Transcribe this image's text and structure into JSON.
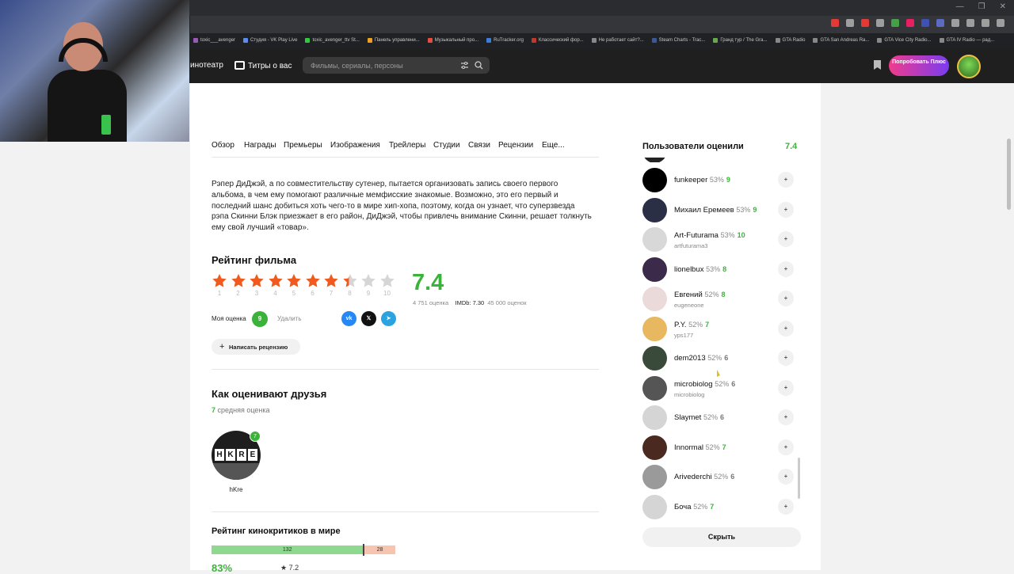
{
  "browser": {
    "bookmarks": [
      "toxic___avenger",
      "Студия - VK Play Live",
      "toxic_avenger_ttv St...",
      "Панель управлени...",
      "Музыкальный про...",
      "RuTracker.org",
      "Классический фор...",
      "Не работает сайт?...",
      "Steam Charts - Trac...",
      "Гранд тур / The Gra...",
      "GTA Radio",
      "GTA San Andreas Ra...",
      "GTA Vice City Radio...",
      "GTA IV Radio — рад..."
    ],
    "bookmark_colors": [
      "#9b59b6",
      "#5a8dee",
      "#2ecc40",
      "#f0a020",
      "#e74c3c",
      "#3b7dd8",
      "#c0392b",
      "#888888",
      "#3b5998",
      "#6aa84f",
      "#888888",
      "#888888",
      "#888888",
      "#888888"
    ],
    "ext_colors": [
      "#e53935",
      "#9e9e9e",
      "#e53935",
      "#9e9e9e",
      "#43a047",
      "#e91e63",
      "#3f51b5",
      "#5c6bc0",
      "#9e9e9e",
      "#9e9e9e",
      "#9e9e9e",
      "#9e9e9e"
    ]
  },
  "header": {
    "nav_cinema": "инотеатр",
    "nav_credits": "Титры о вас",
    "search_placeholder": "Фильмы, сериалы, персоны",
    "plus_button": "Попробовать Плюс"
  },
  "tabs": [
    "Обзор",
    "Награды",
    "Премьеры",
    "Изображения",
    "Трейлеры",
    "Студии",
    "Связи",
    "Рецензии",
    "Еще..."
  ],
  "description": "Рэпер ДиДжэй, а по совместительству сутенер, пытается организовать запись своего первого альбома, в чем ему помогают различные мемфисские знакомые. Возможно, это его первый и последний шанс добиться хоть чего-то в мире хип-хопа, поэтому, когда он узнает, что суперзвезда рэпа Скинни Блэк приезжает в его район, ДиДжэй, чтобы привлечь внимание Скинни, решает толкнуть ему свой лучший «товар».",
  "rating": {
    "title": "Рейтинг фильма",
    "value": "7.4",
    "value_numeric": 7.4,
    "max": 10,
    "star_labels": [
      "1",
      "2",
      "3",
      "4",
      "5",
      "6",
      "7",
      "8",
      "9",
      "10"
    ],
    "count": "4 751 оценка",
    "imdb_label": "IMDb: 7.30",
    "imdb_count": "45 000 оценок",
    "my_rating_label": "Моя оценка",
    "my_rating": "9",
    "remove_label": "Удалить",
    "share": [
      "vk",
      "x",
      "telegram"
    ],
    "write_review": "Написать рецензию"
  },
  "friends": {
    "title": "Как оценивают друзья",
    "avg_value": "7",
    "avg_label": "средняя оценка",
    "items": [
      {
        "name": "hKre",
        "score": "7",
        "avatar_text": [
          "H",
          "K",
          "R",
          "E"
        ]
      }
    ]
  },
  "critics": {
    "title": "Рейтинг кинокритиков в мире",
    "positive": "132",
    "negative": "28",
    "percent": "83%",
    "score": "7.2"
  },
  "sidebar": {
    "title": "Пользователи оценили",
    "score": "7.4",
    "users": [
      {
        "name": "funkeeper",
        "pct": "53%",
        "score": "9",
        "sub": "",
        "color": "#3bb33b",
        "avatar": "#000000"
      },
      {
        "name": "Михаил Еремеев",
        "pct": "53%",
        "score": "9",
        "sub": "",
        "color": "#3bb33b",
        "avatar": "#2b2f45"
      },
      {
        "name": "Art-Futurama",
        "pct": "53%",
        "score": "10",
        "sub": "artfuturama3",
        "color": "#3bb33b",
        "avatar": "#d8d8d8"
      },
      {
        "name": "lionelbux",
        "pct": "53%",
        "score": "8",
        "sub": "",
        "color": "#3bb33b",
        "avatar": "#3b2a4a"
      },
      {
        "name": "Евгений",
        "pct": "52%",
        "score": "8",
        "sub": "eugeneone",
        "color": "#3bb33b",
        "avatar": "#eadada"
      },
      {
        "name": "P.Y.",
        "pct": "52%",
        "score": "7",
        "sub": "yps177",
        "color": "#3bb33b",
        "avatar": "#e8b860"
      },
      {
        "name": "dem2013",
        "pct": "52%",
        "score": "6",
        "sub": "",
        "color": "#777777",
        "avatar": "#3a4a3a"
      },
      {
        "name": "microbiolog",
        "pct": "52%",
        "score": "6",
        "sub": "microbiolog",
        "color": "#777777",
        "avatar": "#555555"
      },
      {
        "name": "Slaymet",
        "pct": "52%",
        "score": "6",
        "sub": "",
        "color": "#777777",
        "avatar": "#d5d5d5"
      },
      {
        "name": "Innormal",
        "pct": "52%",
        "score": "7",
        "sub": "",
        "color": "#3bb33b",
        "avatar": "#4a2a20"
      },
      {
        "name": "Arivederchi",
        "pct": "52%",
        "score": "6",
        "sub": "",
        "color": "#777777",
        "avatar": "#9a9a9a"
      },
      {
        "name": "Боча",
        "pct": "52%",
        "score": "7",
        "sub": "",
        "color": "#3bb33b",
        "avatar": "#d5d5d5"
      }
    ],
    "hide_button": "Скрыть"
  },
  "colors": {
    "accent_green": "#3bb33b",
    "star_orange": "#f05a1e",
    "star_empty": "#d6d6d6"
  }
}
